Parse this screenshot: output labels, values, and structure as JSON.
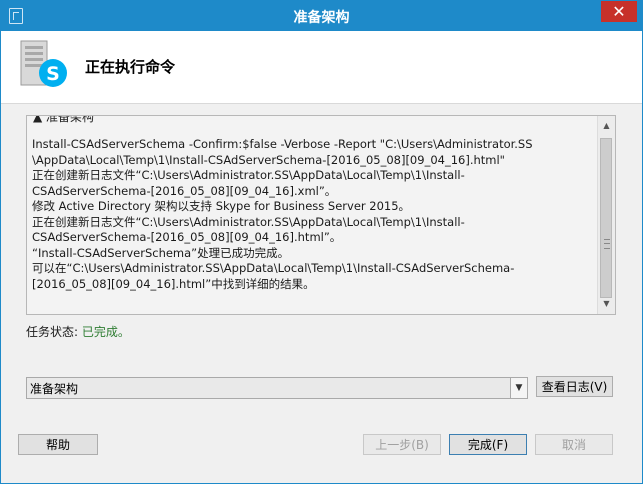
{
  "window": {
    "title": "准备架构",
    "close_label": "✕"
  },
  "header": {
    "title": "正在执行命令"
  },
  "log": {
    "section_label": "▲ 准备架构",
    "lines": [
      "Install-CSAdServerSchema -Confirm:$false -Verbose -Report \"C:\\Users\\Administrator.SS",
      "\\AppData\\Local\\Temp\\1\\Install-CSAdServerSchema-[2016_05_08][09_04_16].html\"",
      "正在创建新日志文件“C:\\Users\\Administrator.SS\\AppData\\Local\\Temp\\1\\Install-",
      "CSAdServerSchema-[2016_05_08][09_04_16].xml”。",
      "修改 Active Directory 架构以支持 Skype for Business Server 2015。",
      "正在创建新日志文件“C:\\Users\\Administrator.SS\\AppData\\Local\\Temp\\1\\Install-",
      "CSAdServerSchema-[2016_05_08][09_04_16].html”。",
      "“Install-CSAdServerSchema”处理已成功完成。",
      "可以在“C:\\Users\\Administrator.SS\\AppData\\Local\\Temp\\1\\Install-CSAdServerSchema-",
      "[2016_05_08][09_04_16].html”中找到详细的结果。"
    ]
  },
  "status": {
    "label": "任务状态:",
    "value": "已完成。",
    "value_color": "#2e7d32"
  },
  "task_select": {
    "selected": "准备架构"
  },
  "buttons": {
    "view_log": "查看日志(V)",
    "help": "帮助",
    "back": "上一步(B)",
    "finish": "完成(F)",
    "cancel": "取消"
  },
  "colors": {
    "titlebar": "#1e8ac9",
    "close": "#c7312a",
    "skype_blue": "#00aff0"
  }
}
